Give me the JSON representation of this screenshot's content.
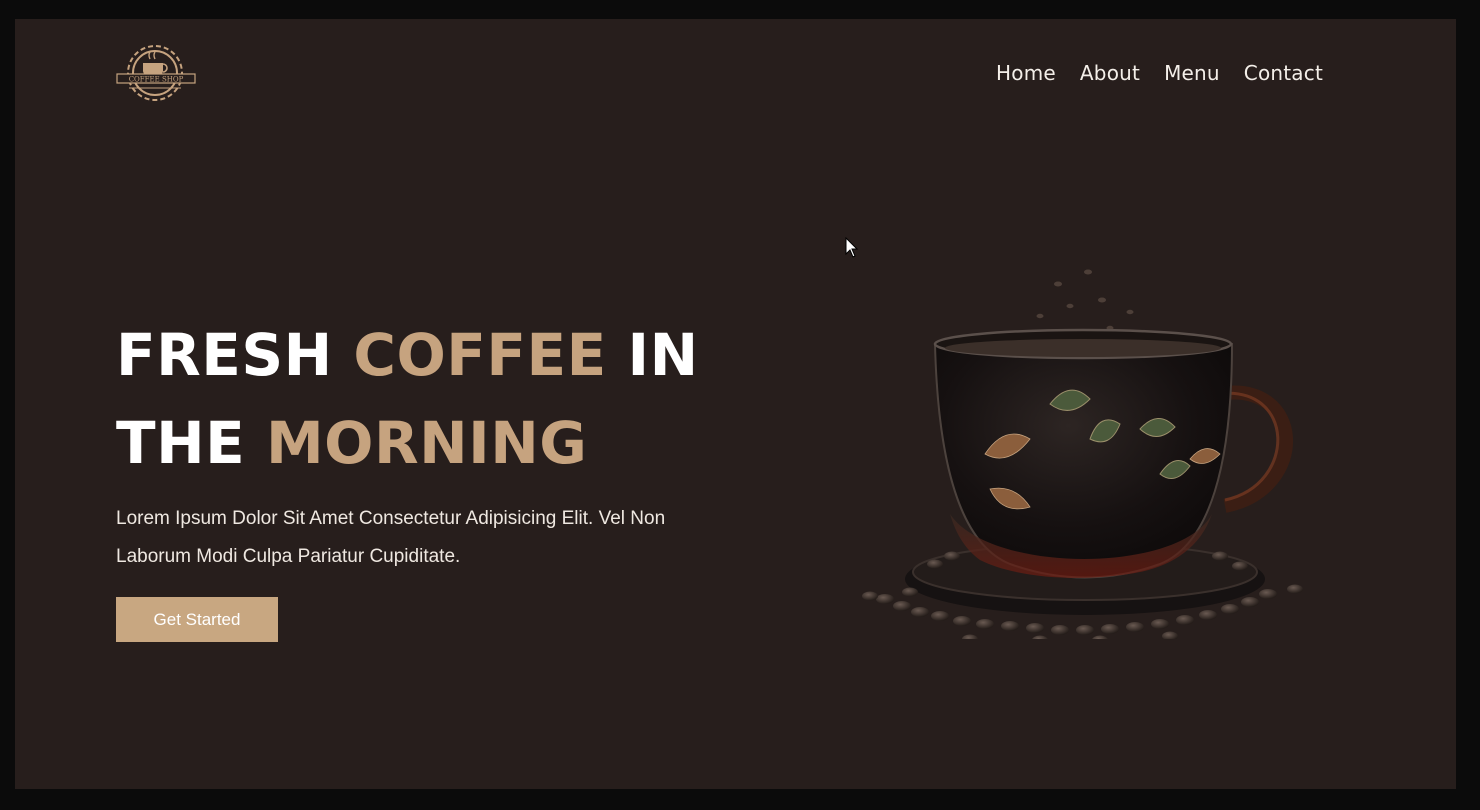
{
  "logo": {
    "text": "COFFEE SHOP",
    "icon": "coffee-cup-gear-emblem"
  },
  "nav": {
    "items": [
      {
        "label": "Home"
      },
      {
        "label": "About"
      },
      {
        "label": "Menu"
      },
      {
        "label": "Contact"
      }
    ]
  },
  "hero": {
    "title_line1_part1": "FRESH",
    "title_line1_accent": "COFFEE",
    "title_line1_part2": "IN",
    "title_line2_part1": "THE",
    "title_line2_accent": "MORNING",
    "description": "Lorem Ipsum Dolor Sit Amet Consectetur Adipisicing Elit. Vel Non Laborum Modi Culpa Pariatur Cupiditate.",
    "cta_label": "Get Started"
  },
  "colors": {
    "background": "#271e1c",
    "accent": "#c6a37f",
    "button": "#c8a781",
    "text": "#ffffff"
  }
}
